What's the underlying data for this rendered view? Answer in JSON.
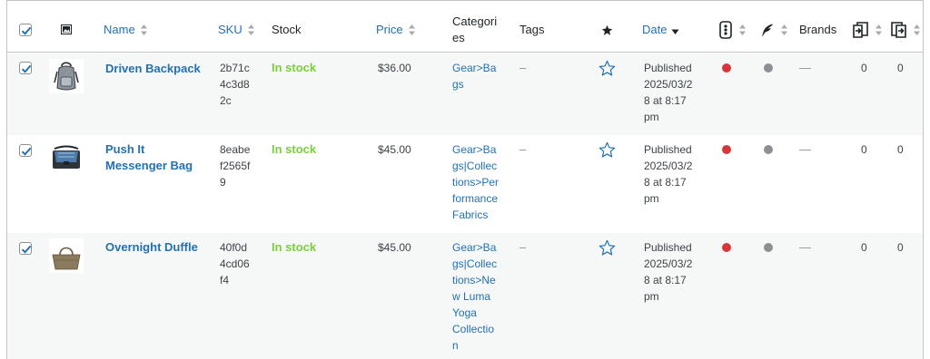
{
  "columns": {
    "name": "Name",
    "sku": "SKU",
    "stock": "Stock",
    "price": "Price",
    "categories": "Categories",
    "tags": "Tags",
    "date": "Date",
    "brands": "Brands"
  },
  "colors": {
    "link": "#2271b1",
    "in_stock": "#7ad03a",
    "seo_dot": "#d63638",
    "readability_dot": "#8c8f94",
    "row_alt": "#f6f7f7"
  },
  "products": [
    {
      "name": "Driven Backpack",
      "name_lines": [
        "Driven Backpack"
      ],
      "sku_lines": [
        "2b71c",
        "4c3d8",
        "2c"
      ],
      "stock": "In stock",
      "price": "$36.00",
      "category_lines": [
        "Gear>Ba",
        "gs"
      ],
      "tags": "–",
      "featured_icon": "star-outline-icon",
      "date_lines": [
        "Published",
        "2025/03/2",
        "8 at 8:17",
        "pm"
      ],
      "brand": "—",
      "col_a": "0",
      "col_b": "0",
      "checked": true,
      "thumbnail": "backpack-thumbnail"
    },
    {
      "name": "Push It Messenger Bag",
      "name_lines": [
        "Push It",
        "Messenger Bag"
      ],
      "sku_lines": [
        "8eabe",
        "f2565f",
        "9"
      ],
      "stock": "In stock",
      "price": "$45.00",
      "category_lines": [
        "Gear>Ba",
        "gs|Collec",
        "tions>Per",
        "formance",
        "Fabrics"
      ],
      "tags": "–",
      "featured_icon": "star-outline-icon",
      "date_lines": [
        "Published",
        "2025/03/2",
        "8 at 8:17",
        "pm"
      ],
      "brand": "—",
      "col_a": "0",
      "col_b": "0",
      "checked": true,
      "thumbnail": "messenger-bag-thumbnail"
    },
    {
      "name": "Overnight Duffle",
      "name_lines": [
        "Overnight Duffle"
      ],
      "sku_lines": [
        "40f0d",
        "4cd06",
        "f4"
      ],
      "stock": "In stock",
      "price": "$45.00",
      "category_lines": [
        "Gear>Ba",
        "gs|Collec",
        "tions>Ne",
        "w Luma",
        "Yoga",
        "Collectio",
        "n"
      ],
      "tags": "–",
      "featured_icon": "star-outline-icon",
      "date_lines": [
        "Published",
        "2025/03/2",
        "8 at 8:17",
        "pm"
      ],
      "brand": "—",
      "col_a": "0",
      "col_b": "0",
      "checked": true,
      "thumbnail": "duffle-bag-thumbnail"
    }
  ]
}
